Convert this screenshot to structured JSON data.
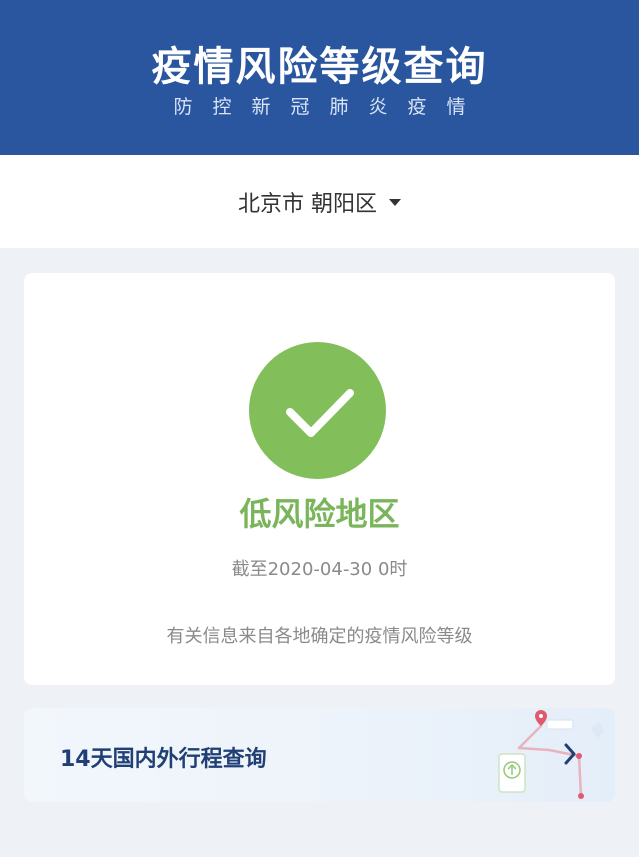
{
  "header": {
    "title": "疫情风险等级查询",
    "subtitle": "防控新冠肺炎疫情"
  },
  "region": {
    "selected": "北京市 朝阳区"
  },
  "status": {
    "icon": "check-icon",
    "level": "低风险地区",
    "updated": "截至2020-04-30 0时",
    "note": "有关信息来自各地确定的疫情风险等级"
  },
  "trip": {
    "label": "14天国内外行程查询"
  },
  "colors": {
    "header_bg": "#2a56a0",
    "low_risk_green": "#82bf5a",
    "trip_text": "#1f3f75"
  }
}
